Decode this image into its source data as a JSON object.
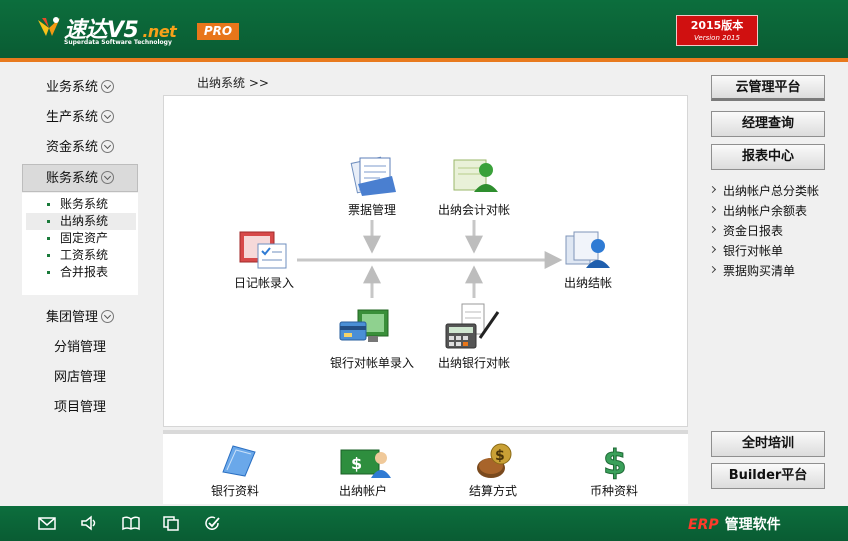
{
  "header": {
    "logo_main": "速达V5",
    "logo_net": ".net",
    "logo_sub": "Superdata Software Technology",
    "pro_badge": "PRO",
    "version_line1": "2015版本",
    "version_line2": "Version 2015"
  },
  "sidebar": {
    "items": [
      {
        "label": "业务系统"
      },
      {
        "label": "生产系统"
      },
      {
        "label": "资金系统"
      },
      {
        "label": "账务系统"
      }
    ],
    "submenu": [
      {
        "label": "账务系统"
      },
      {
        "label": "出纳系统"
      },
      {
        "label": "固定资产"
      },
      {
        "label": "工资系统"
      },
      {
        "label": "合并报表"
      }
    ],
    "lower_items": [
      {
        "label": "集团管理"
      },
      {
        "label": "分销管理"
      },
      {
        "label": "网店管理"
      },
      {
        "label": "项目管理"
      }
    ]
  },
  "breadcrumb": "出纳系统  >>",
  "flow": {
    "piaoju": "票据管理",
    "kuaiji_duizhang": "出纳会计对帐",
    "riji": "日记帐录入",
    "jiezhang": "出纳结帐",
    "yinhang_luru": "银行对帐单录入",
    "yinhang_duizhang": "出纳银行对帐"
  },
  "bottom": {
    "bank": "银行资料",
    "account": "出纳帐户",
    "settle": "结算方式",
    "currency": "币种资料"
  },
  "right": {
    "cloud": "云管理平台",
    "manager": "经理查询",
    "report": "报表中心",
    "links": [
      {
        "label": "出纳帐户总分类帐"
      },
      {
        "label": "出纳帐户余额表"
      },
      {
        "label": "资金日报表"
      },
      {
        "label": "银行对帐单"
      },
      {
        "label": "票据购买清单"
      }
    ],
    "training": "全时培训",
    "builder": "Builder平台"
  },
  "footer": {
    "erp": "ERP",
    "brand": "管理软件"
  },
  "colors": {
    "header_green": "#0c6e3d",
    "accent_orange": "#e87a1e",
    "version_red": "#d01010"
  }
}
